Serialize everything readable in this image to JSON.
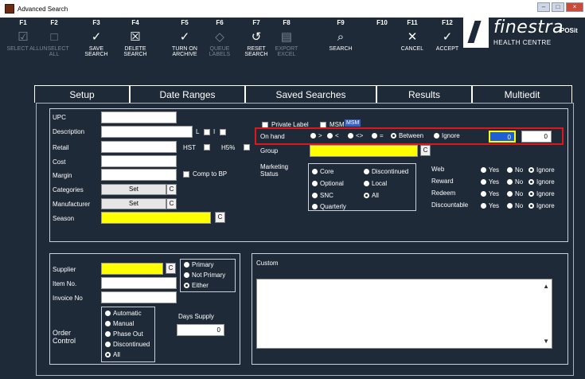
{
  "window": {
    "title": "Advanced Search",
    "controls": [
      "–",
      "□",
      "×"
    ]
  },
  "toolbar": [
    {
      "key": "F1",
      "label": "SELECT ALL",
      "icon": "checkbox-icon",
      "glyph": "☑",
      "dim": true
    },
    {
      "key": "F2",
      "label": "UNSELECT ALL",
      "icon": "empty-checkbox-icon",
      "glyph": "□",
      "dim": true
    },
    {
      "key": "F3",
      "label": "SAVE SEARCH",
      "icon": "checkmark-icon",
      "glyph": "✓",
      "dim": false
    },
    {
      "key": "F4",
      "label": "DELETE SEARCH",
      "icon": "delete-box-icon",
      "glyph": "☒",
      "dim": false
    },
    {
      "key": "F5",
      "label": "TURN ON ARCHIVE",
      "icon": "checkmark-icon",
      "glyph": "✓",
      "dim": false
    },
    {
      "key": "F6",
      "label": "QUEUE LABELS",
      "icon": "tag-icon",
      "glyph": "◇",
      "dim": true
    },
    {
      "key": "F7",
      "label": "RESET SEARCH",
      "icon": "reset-icon",
      "glyph": "↺",
      "dim": false
    },
    {
      "key": "F8",
      "label": "EXPORT EXCEL",
      "icon": "document-icon",
      "glyph": "▤",
      "dim": true
    },
    {
      "key": "F9",
      "label": "SEARCH",
      "icon": "search-icon",
      "glyph": "⌕",
      "dim": false
    },
    {
      "key": "F10",
      "label": "",
      "icon": "",
      "glyph": "",
      "dim": false
    },
    {
      "key": "F11",
      "label": "CANCEL",
      "icon": "close-icon",
      "glyph": "✕",
      "dim": false
    },
    {
      "key": "F12",
      "label": "ACCEPT",
      "icon": "checkmark-icon",
      "glyph": "✓",
      "dim": false
    }
  ],
  "logo": {
    "brand": "finestra",
    "sub": "HEALTH CENTRE",
    "partner": "POSit"
  },
  "tabs": [
    "Setup",
    "Date Ranges",
    "Saved Searches",
    "Results",
    "Multiedit"
  ],
  "left_fields": {
    "upc": "UPC",
    "description": "Description",
    "retail": "Retail",
    "cost": "Cost",
    "margin": "Margin",
    "categories": "Categories",
    "manufacturer": "Manufacturer",
    "season": "Season",
    "set_label": "Set",
    "c_label": "C",
    "l_label": "L",
    "i_label": "I",
    "hst_label": "HST",
    "h5_label": "H5%",
    "comp_label": "Comp to BP"
  },
  "right_fields": {
    "private_label": "Private Label",
    "msm": "MSM",
    "msm_badge": "MSM",
    "on_hand": "On hand",
    "group": "Group",
    "marketing_status": "Marketing Status",
    "on_hand_ops": [
      ">",
      "<",
      "<>",
      "=",
      "Between",
      "Ignore"
    ],
    "on_hand_val1": "0",
    "on_hand_val2": "0",
    "marketing_options": [
      "Core",
      "Discontinued",
      "Optional",
      "Local",
      "SNC",
      "All",
      "Quarterly"
    ],
    "flags": [
      "Web",
      "Reward",
      "Redeem",
      "Discountable"
    ],
    "flag_opts": [
      "Yes",
      "No",
      "Ignore"
    ]
  },
  "supplier": {
    "supplier": "Supplier",
    "item_no": "Item No.",
    "invoice_no": "Invoice No",
    "primary": "Primary",
    "not_primary": "Not Primary",
    "either": "Either",
    "order_control": "Order Control",
    "order_options": [
      "Automatic",
      "Manual",
      "Phase Out",
      "Discontinued",
      "All"
    ],
    "days_supply": "Days Supply",
    "days_value": "0"
  },
  "custom": {
    "label": "Custom"
  }
}
